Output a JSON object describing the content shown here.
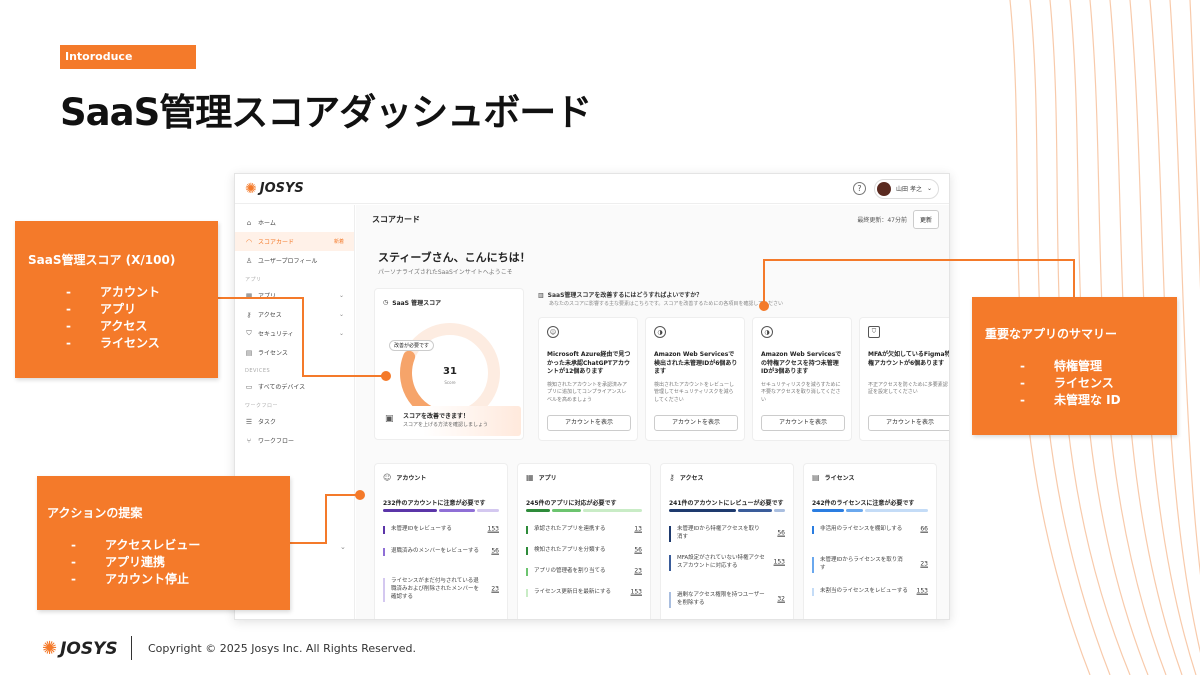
{
  "intro_badge": "Intoroduce",
  "page_title": "SaaS管理スコアダッシュボード",
  "colors": {
    "accent": "#f47a2a"
  },
  "app": {
    "logo_text": "JOSYS",
    "help_icon": "question-circle-icon",
    "user_name": "山田 孝之",
    "sidebar": {
      "home": "ホーム",
      "scorecard": "スコアカード",
      "scorecard_badge": "新着",
      "user_profile": "ユーザープロフィール",
      "section_apps": "アプリ",
      "apps": "アプリ",
      "access": "アクセス",
      "security": "セキュリティ",
      "license": "ライセンス",
      "section_devices": "DEVICES",
      "all_devices": "すべてのデバイス",
      "section_workflow": "ワークフロー",
      "tasks": "タスク",
      "workflow": "ワークフロー"
    },
    "header": {
      "title": "スコアカード",
      "last_update": "最終更新：47分前",
      "refresh": "更新"
    },
    "greeting": "スティーブさん、こんにちは！",
    "greeting_sub": "パーソナライズされたSaaSインサイトへようこそ",
    "score_card": {
      "title": "SaaS 管理スコア",
      "badge": "改善が必要です",
      "score": "31",
      "score_label": "Score",
      "score_value": 31,
      "score_max": 100,
      "improve_title": "スコアを改善できます！",
      "improve_sub": "スコアを上げる方法を確認しましょう"
    },
    "recommend": {
      "title": "SaaS管理スコアを改善するにはどうすればよいですか？",
      "sub": "あなたのスコアに影響する主な要素はこちらです。スコアを改善するためにの各項目を確認してください",
      "cards": [
        {
          "icon": "user-circle-icon",
          "title": "Microsoft Azure経由で見つかった未承認ChatGPTアカウントが12個あります",
          "desc": "検知されたアカウントを承認済みアプリに追加してコンプライアンスレベルを高めましょう",
          "button": "アカウントを表示"
        },
        {
          "icon": "half-circle-icon",
          "title": "Amazon Web Servicesで検出された未管理IDが6個あります",
          "desc": "検出されたアカウントをレビューし管理してセキュリティリスクを減らしてください",
          "button": "アカウントを表示"
        },
        {
          "icon": "half-circle-icon",
          "title": "Amazon Web Servicesでの特権アクセスを持つ未管理IDが3個あります",
          "desc": "セキュリティリスクを減らすために不要なアクセスを取り消してください",
          "button": "アカウントを表示"
        },
        {
          "icon": "shield-icon",
          "title": "MFAが欠如しているFigma特権アカウントが6個あります",
          "desc": "不正アクセスを防ぐために多要素認証を設定してください",
          "button": "アカウントを表示"
        }
      ]
    },
    "categories": [
      {
        "icon": "account-icon",
        "title": "アカウント",
        "need": "232件のアカウントに注意が必要です",
        "bar_colors": [
          "#5b35a8",
          "#8f6fd6",
          "#d4c8f0"
        ],
        "tasks": [
          {
            "text": "未管理IDをレビューする",
            "count": "153",
            "color": "#5b35a8"
          },
          {
            "text": "退職済みのメンバーをレビューする",
            "count": "56",
            "color": "#8f6fd6"
          },
          {
            "text": "ライセンスがまだ付与されている退職済みおよび削除されたメンバーを確認する",
            "count": "23",
            "color": "#d4c8f0"
          }
        ]
      },
      {
        "icon": "grid-icon",
        "title": "アプリ",
        "need": "245件のアプリに対応が必要です",
        "bar_colors": [
          "#2e8b3a",
          "#6cc46f",
          "#c9ecc6"
        ],
        "tasks": [
          {
            "text": "承認されたアプリを連携する",
            "count": "13",
            "color": "#2e8b3a"
          },
          {
            "text": "検知されたアプリを分類する",
            "count": "56",
            "color": "#2e8b3a"
          },
          {
            "text": "アプリの管理者を割り当てる",
            "count": "23",
            "color": "#6cc46f"
          },
          {
            "text": "ライセンス更新日を最新にする",
            "count": "153",
            "color": "#c9ecc6"
          }
        ]
      },
      {
        "icon": "access-icon",
        "title": "アクセス",
        "need": "241件のアカウントにレビューが必要です",
        "bar_colors": [
          "#1e3a6e",
          "#3a5c9a",
          "#a9bedf"
        ],
        "tasks": [
          {
            "text": "未管理IDから特権アクセスを取り消す",
            "count": "56",
            "color": "#1e3a6e"
          },
          {
            "text": "MFA設定がされていない特権アクセスアカウントに対応する",
            "count": "153",
            "color": "#3a5c9a"
          },
          {
            "text": "過剰なアクセス権限を持つユーザーを削除する",
            "count": "32",
            "color": "#a9bedf"
          }
        ]
      },
      {
        "icon": "license-icon",
        "title": "ライセンス",
        "need": "242件のライセンスに注意が必要です",
        "bar_colors": [
          "#2a7de1",
          "#6aa8ee",
          "#c4dcf7"
        ],
        "tasks": [
          {
            "text": "非活用のライセンスを棚卸しする",
            "count": "66",
            "color": "#2a7de1"
          },
          {
            "text": "未管理IDからライセンスを取り消す",
            "count": "23",
            "color": "#6aa8ee"
          },
          {
            "text": "未割当のライセンスをレビューする",
            "count": "153",
            "color": "#c4dcf7"
          }
        ]
      }
    ]
  },
  "callouts": {
    "score": {
      "title": "SaaS管理スコア (X/100)",
      "items": [
        "アカウント",
        "アプリ",
        "アクセス",
        "ライセンス"
      ]
    },
    "summary": {
      "title": "重要なアプリのサマリー",
      "items": [
        "特権管理",
        "ライセンス",
        "未管理な ID"
      ]
    },
    "actions": {
      "title": "アクションの提案",
      "items": [
        "アクセスレビュー",
        "アプリ連携",
        "アカウント停止"
      ]
    }
  },
  "footer": {
    "logo_text": "JOSYS",
    "copyright": "Copyright © 2025 Josys Inc. All Rights Reserved."
  }
}
